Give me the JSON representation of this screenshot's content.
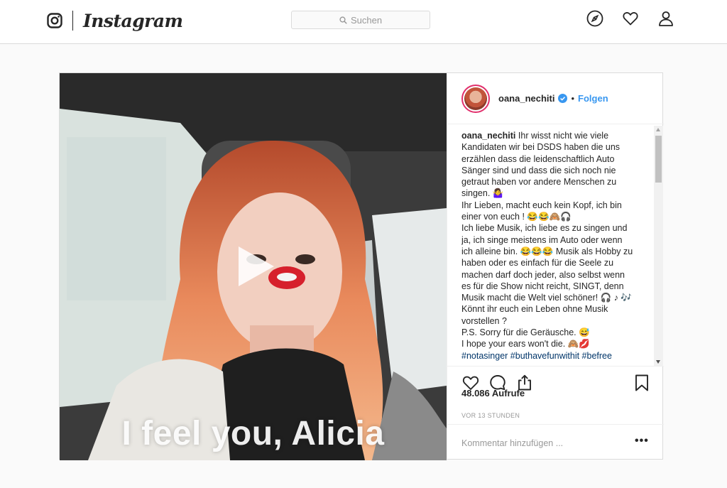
{
  "brand": {
    "name": "Instagram"
  },
  "search": {
    "placeholder": "Suchen"
  },
  "nav": {
    "icons": [
      "compass-icon",
      "heart-icon",
      "profile-icon"
    ]
  },
  "post": {
    "username": "oana_nechiti",
    "verified": true,
    "separator": "•",
    "follow_label": "Folgen",
    "video_overlay_text": "I feel you, Alicia",
    "caption_lines": [
      "Ihr wisst nicht wie viele",
      "Kandidaten wir bei DSDS haben die uns",
      "erzählen dass die leidenschaftlich Auto",
      "Sänger sind und dass die sich noch nie",
      "getraut haben vor andere Menschen zu",
      "singen. 🤷‍♀️",
      "Ihr Lieben, macht euch kein Kopf, ich bin",
      "einer von euch ! 😂😂🙈🎧",
      "Ich liebe Musik, ich liebe es zu singen und",
      "ja, ich singe meistens im Auto oder wenn",
      "ich alleine bin. 😂😂😂 Musik als Hobby zu",
      "haben oder es einfach für die Seele zu",
      "machen darf doch jeder, also selbst wenn",
      "es für die Show nicht reicht, SINGT, denn",
      "Musik macht die Welt viel schöner! 🎧 ♪ 🎶",
      "Könnt ihr euch ein Leben ohne Musik",
      "vorstellen ?",
      "P.S. Sorry für die Geräusche. 😅",
      "I hope your ears won't die. 🙈💋"
    ],
    "hashtags": "#notasinger #buthavefunwithit #befree",
    "views": "48.086 Aufrufe",
    "time_ago": "VOR 13 STUNDEN",
    "comment_placeholder": "Kommentar hinzufügen ...",
    "more_label": "•••"
  }
}
